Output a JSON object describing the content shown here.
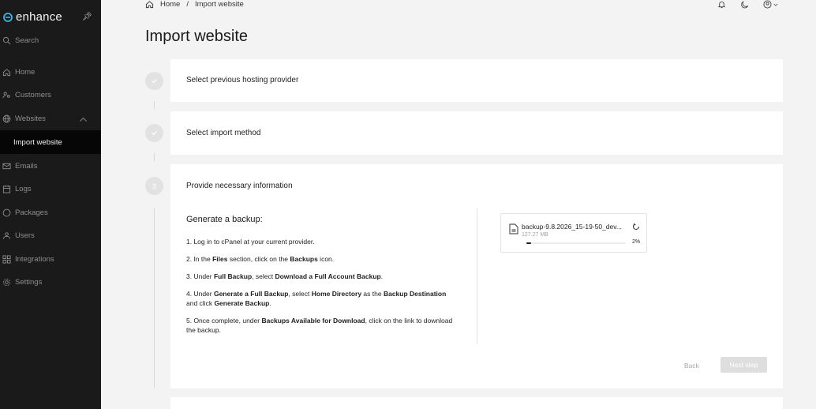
{
  "app": {
    "brand": "enhance"
  },
  "sidebar": {
    "search": "Search",
    "items": [
      {
        "label": "Home",
        "icon": "home-icon"
      },
      {
        "label": "Customers",
        "icon": "customers-icon"
      },
      {
        "label": "Websites",
        "icon": "globe-icon"
      },
      {
        "label": "Import website",
        "icon": ""
      },
      {
        "label": "Emails",
        "icon": "mail-icon"
      },
      {
        "label": "Logs",
        "icon": "logs-icon"
      },
      {
        "label": "Packages",
        "icon": "package-icon"
      },
      {
        "label": "Users",
        "icon": "users-icon"
      },
      {
        "label": "Integrations",
        "icon": "integrations-icon"
      },
      {
        "label": "Settings",
        "icon": "gear-icon"
      }
    ]
  },
  "breadcrumb": {
    "home": "Home",
    "separator": "/",
    "current": "Import website"
  },
  "page": {
    "title": "Import website"
  },
  "steps": [
    {
      "label": "Select previous hosting provider",
      "status": "done"
    },
    {
      "label": "Select import method",
      "status": "done"
    },
    {
      "number": "3",
      "label": "Provide necessary information",
      "status": "active"
    }
  ],
  "backup": {
    "heading": "Generate a backup:",
    "step1": "1. Log in to cPanel at your current provider.",
    "step2": {
      "a": "2. In the ",
      "b": "Files",
      "c": " section, click on the ",
      "d": "Backups",
      "e": " icon."
    },
    "step3": {
      "a": "3. Under ",
      "b": "Full Backup",
      "c": ", select ",
      "d": "Download a Full Account Backup",
      "e": "."
    },
    "step4": {
      "a": "4. Under ",
      "b": "Generate a Full Backup",
      "c": ", select ",
      "d": "Home Directory",
      "e": " as the ",
      "f": "Backup Destination",
      "g": " and click ",
      "h": "Generate Backup",
      "i": "."
    },
    "step5": {
      "a": "5. Once complete, under ",
      "b": "Backups Available for Download",
      "c": ", click on the link to download the backup."
    }
  },
  "upload": {
    "file_name": "backup-9.8.2026_15-19-50_dev...",
    "file_size": "127.27 MB",
    "progress_percent": 2,
    "progress_label": "2%"
  },
  "actions": {
    "back": "Back",
    "next": "Next step"
  },
  "colors": {
    "sidebar_bg": "#1a1a1a",
    "active_item_bg": "#060606",
    "page_bg": "#f3f3f3",
    "disabled_button": "#dedede"
  }
}
